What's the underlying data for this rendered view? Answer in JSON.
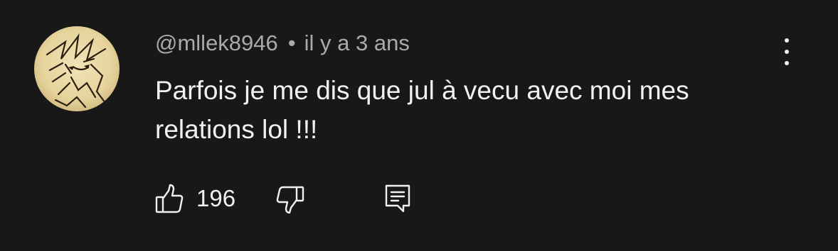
{
  "comment": {
    "author": "@mllek8946",
    "separator": "•",
    "time": "il y a 3 ans",
    "text": "Parfois je me dis que jul à vecu avec moi mes relations lol !!!",
    "likes": "196"
  },
  "icons": {
    "avatar": "avatar-image",
    "more": "more-vertical-icon",
    "like": "thumbs-up-icon",
    "dislike": "thumbs-down-icon",
    "reply": "comment-reply-icon"
  },
  "colors": {
    "background": "#181818",
    "text_primary": "#f1f1f1",
    "text_secondary": "#aaaaaa",
    "avatar_bg": "#e8d8a8"
  }
}
